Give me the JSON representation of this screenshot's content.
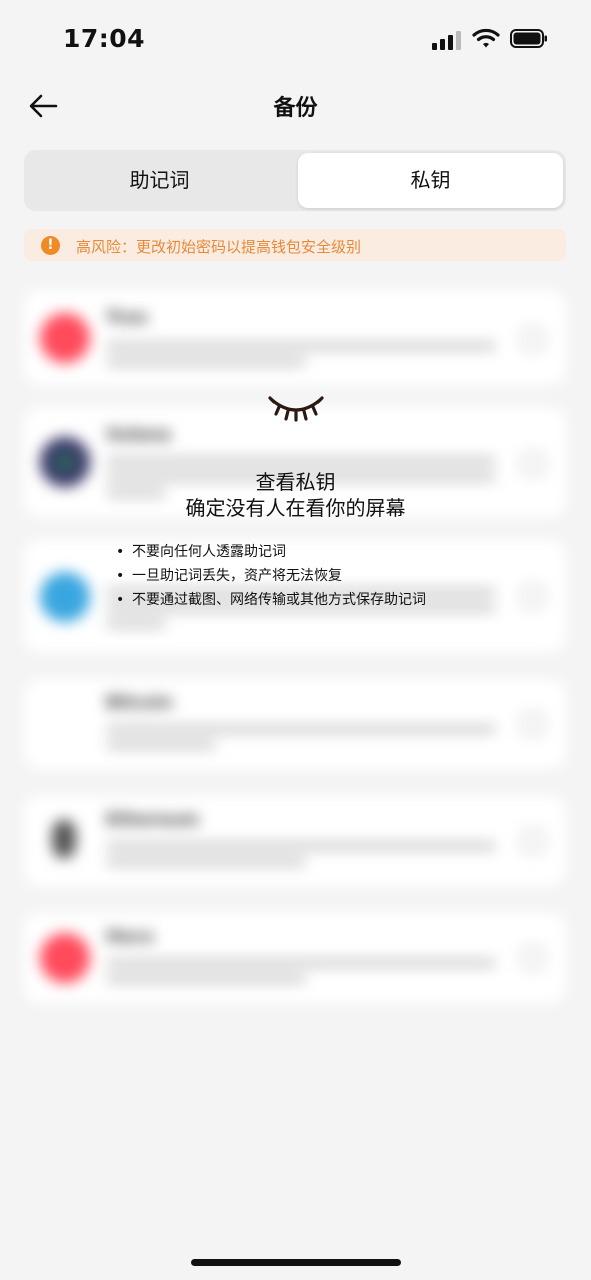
{
  "status": {
    "time": "17:04"
  },
  "nav": {
    "title": "备份"
  },
  "tabs": [
    {
      "label": "助记词"
    },
    {
      "label": "私钥"
    }
  ],
  "warning": {
    "text": "高风险：更改初始密码以提高钱包安全级别"
  },
  "coins": [
    {
      "name": "Tron",
      "color": "#ff4b5c"
    },
    {
      "name": "Solana",
      "color": "#3a2f6b"
    },
    {
      "name": "",
      "color": "#3aa6e0"
    },
    {
      "name": "Bitcoin",
      "color": "#ffffff"
    },
    {
      "name": "Ethereum",
      "color": "#666666"
    },
    {
      "name": "Heco",
      "color": "#ff4b5c"
    }
  ],
  "overlay": {
    "title_line1": "查看私钥",
    "title_line2": "确定没有人在看你的屏幕",
    "tips": [
      "不要向任何人透露助记词",
      "一旦助记词丢失，资产将无法恢复",
      "不要通过截图、网络传输或其他方式保存助记词"
    ]
  },
  "colors": {
    "accent": "#f08a24",
    "warning_bg": "#fbece2"
  }
}
